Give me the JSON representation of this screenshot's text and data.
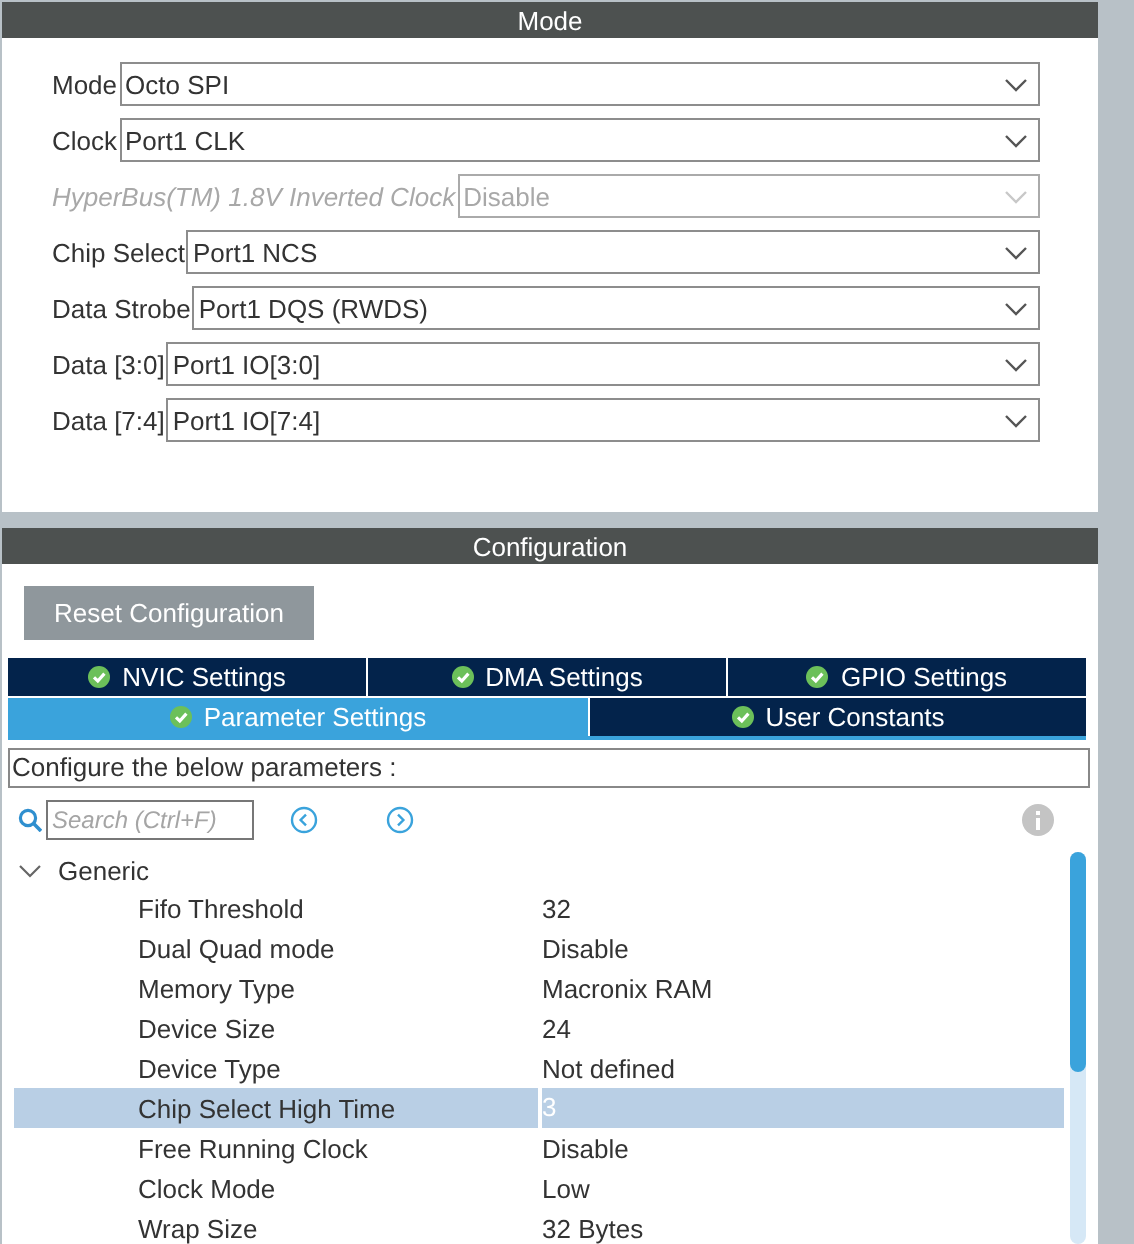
{
  "mode_panel": {
    "title": "Mode",
    "fields": [
      {
        "label": "Mode",
        "value": "Octo SPI",
        "disabled": false
      },
      {
        "label": "Clock",
        "value": "Port1 CLK",
        "disabled": false
      },
      {
        "label": "HyperBus(TM) 1.8V Inverted Clock",
        "value": "Disable",
        "disabled": true
      },
      {
        "label": "Chip Select",
        "value": "Port1 NCS",
        "disabled": false
      },
      {
        "label": "Data Strobe",
        "value": "Port1 DQS (RWDS)",
        "disabled": false
      },
      {
        "label": "Data [3:0]",
        "value": "Port1 IO[3:0]",
        "disabled": false
      },
      {
        "label": "Data [7:4]",
        "value": "Port1 IO[7:4]",
        "disabled": false
      }
    ]
  },
  "configuration": {
    "title": "Configuration",
    "reset_button": "Reset Configuration",
    "tab_rows": [
      {
        "tabs": [
          {
            "label": "NVIC Settings",
            "selected": false
          },
          {
            "label": "DMA Settings",
            "selected": false
          },
          {
            "label": "GPIO Settings",
            "selected": false
          }
        ]
      },
      {
        "tabs": [
          {
            "label": "Parameter Settings",
            "selected": true
          },
          {
            "label": "User Constants",
            "selected": false
          }
        ]
      }
    ],
    "description": "Configure the below parameters :",
    "search": {
      "placeholder": "Search (Ctrl+F)"
    },
    "tree": [
      {
        "label": "Generic",
        "expanded": true,
        "children": [
          {
            "name": "Fifo Threshold",
            "value": "32",
            "selected": false
          },
          {
            "name": "Dual Quad mode",
            "value": "Disable",
            "selected": false
          },
          {
            "name": "Memory Type",
            "value": "Macronix RAM",
            "selected": false
          },
          {
            "name": "Device Size",
            "value": "24",
            "selected": false
          },
          {
            "name": "Device Type",
            "value": "Not defined",
            "selected": false
          },
          {
            "name": "Chip Select High Time",
            "value": "3",
            "selected": true
          },
          {
            "name": "Free Running Clock",
            "value": "Disable",
            "selected": false
          },
          {
            "name": "Clock Mode",
            "value": "Low",
            "selected": false
          },
          {
            "name": "Wrap Size",
            "value": "32 Bytes",
            "selected": false
          }
        ]
      }
    ]
  }
}
